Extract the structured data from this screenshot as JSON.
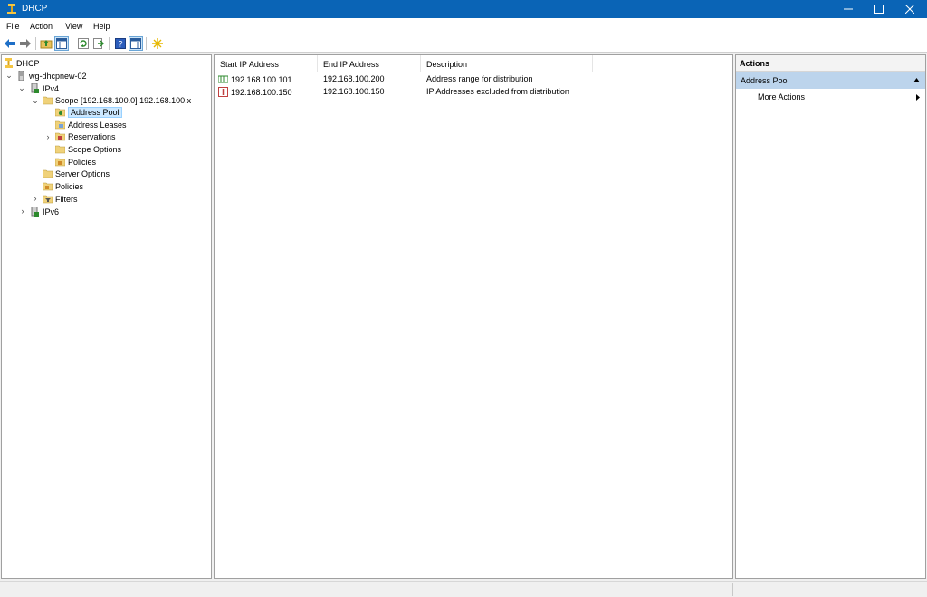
{
  "window": {
    "title": "DHCP"
  },
  "menu": [
    "File",
    "Action",
    "View",
    "Help"
  ],
  "tree": {
    "root": "DHCP",
    "server": "wg-dhcpnew-02",
    "ipv4": "IPv4",
    "scope": "Scope [192.168.100.0] 192.168.100.x",
    "address_pool": "Address Pool",
    "address_leases": "Address Leases",
    "reservations": "Reservations",
    "scope_options": "Scope Options",
    "scope_policies": "Policies",
    "server_options": "Server Options",
    "policies": "Policies",
    "filters": "Filters",
    "ipv6": "IPv6"
  },
  "list": {
    "columns": [
      "Start IP Address",
      "End IP Address",
      "Description"
    ],
    "rows": [
      {
        "start": "192.168.100.101",
        "end": "192.168.100.200",
        "description": "Address range for distribution",
        "icon": "range-icon"
      },
      {
        "start": "192.168.100.150",
        "end": "192.168.100.150",
        "description": "IP Addresses excluded from distribution",
        "icon": "exclusion-icon"
      }
    ]
  },
  "actions": {
    "header": "Actions",
    "section": "Address Pool",
    "more": "More Actions"
  },
  "colors": {
    "titlebar": "#0a64b6",
    "selection": "#cce8ff",
    "actions_section": "#bcd4ec"
  }
}
